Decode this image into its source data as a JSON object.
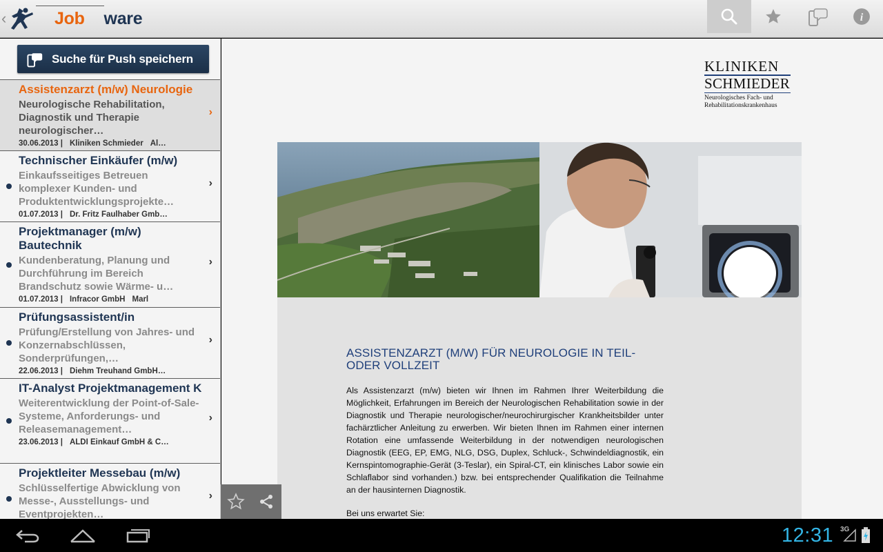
{
  "app": {
    "logo_part1": "Job",
    "logo_part2": "ware"
  },
  "toolbar": {
    "icons": [
      "search-icon",
      "star-icon",
      "push-icon",
      "info-icon"
    ]
  },
  "save_search": {
    "label": "Suche für Push speichern"
  },
  "jobs": [
    {
      "title": "Assistenzarzt (m/w) Neurologie",
      "desc": "Neurologische Rehabilitation, Diagnostik und Therapie neurologischer…",
      "date": "30.06.2013 |",
      "company": "Kliniken Schmieder",
      "city": "Al…",
      "selected": true
    },
    {
      "title": "Technischer Einkäufer (m/w)",
      "desc": "Einkaufsseitiges Betreuen komplexer Kunden- und Produktentwicklungsprojekte…",
      "date": "01.07.2013 |",
      "company": "Dr. Fritz Faulhaber Gmb…",
      "city": ""
    },
    {
      "title": "Projektmanager (m/w) Bautechnik",
      "desc": "Kundenberatung, Planung und Durchführung im Bereich Brandschutz sowie Wärme- u…",
      "date": "01.07.2013 |",
      "company": "Infracor GmbH",
      "city": "Marl"
    },
    {
      "title": "Prüfungsassistent/in",
      "desc": "Prüfung/Erstellung von Jahres- und Konzernabschlüssen, Sonderprüfungen,…",
      "date": "22.06.2013 |",
      "company": "Diehm Treuhand GmbH…",
      "city": ""
    },
    {
      "title": "IT-Analyst Projektmanagement Kassensysteme (International…",
      "desc": "Weiterentwicklung der Point-of-Sale-Systeme, Anforderungs- und Releasemanagement…",
      "date": "23.06.2013 |",
      "company": "ALDI Einkauf GmbH & C…",
      "city": ""
    },
    {
      "title": "Projektleiter Messebau (m/w)",
      "desc": "Schlüsselfertige Abwicklung von Messe-, Ausstellungs- und Eventprojekten…",
      "date": "",
      "company": "",
      "city": ""
    }
  ],
  "detail": {
    "clinic": {
      "line1": "KLINIKEN",
      "line2": "SCHMIEDER",
      "line3": "Neurologisches Fach- und",
      "line4": "Rehabilitationskrankenhaus"
    },
    "headline": "ASSISTENZARZT (M/W) FÜR NEUROLOGIE IN TEIL- ODER VOLLZEIT",
    "body": "Als Assistenzarzt (m/w) bieten wir Ihnen im Rahmen Ihrer Weiterbildung die Möglichkeit, Erfahrungen im Bereich der Neurologischen Rehabilitation sowie in der Diagnostik und Therapie neurologischer/neurochirurgischer Krankheitsbilder unter fachärztlicher Anleitung zu erwerben. Wir bieten Ihnen im Rahmen einer internen Rotation eine umfassende Weiterbildung in der notwendigen neurologischen Diagnostik (EEG, EP, EMG, NLG, DSG, Duplex, Schluck-, Schwindeldiagnostik, ein Kernspintomographie-Gerät (3-Teslar), ein Spiral-CT, ein klinisches Labor sowie ein Schlaflabor sind vorhanden.) bzw. bei entsprechender Qualifikation die Teilnahme an der hausinternen Diagnostik.",
    "expect": "Bei uns erwartet Sie:"
  },
  "status": {
    "time": "12:31",
    "network": "3G"
  }
}
